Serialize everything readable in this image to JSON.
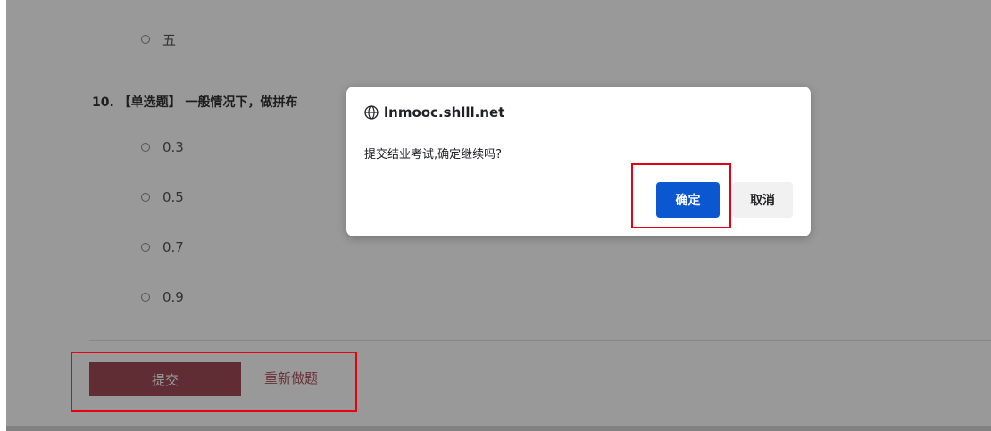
{
  "question_9": {
    "options": [
      {
        "label": "五"
      }
    ]
  },
  "question_10": {
    "title": "10. 【单选题】 一般情况下，做拼布",
    "options": [
      {
        "label": "0.3"
      },
      {
        "label": "0.5"
      },
      {
        "label": "0.7"
      },
      {
        "label": "0.9"
      }
    ]
  },
  "actions": {
    "submit_label": "提交",
    "redo_label": "重新做题"
  },
  "dialog": {
    "origin": "lnmooc.shlll.net",
    "message": "提交结业考试,确定继续吗?",
    "ok_label": "确定",
    "cancel_label": "取消",
    "icon": "globe-icon"
  },
  "colors": {
    "submit_button": "#9e4b56",
    "redo_link": "#b0505c",
    "dialog_ok": "#0b57d0",
    "highlight": "#e60012"
  }
}
